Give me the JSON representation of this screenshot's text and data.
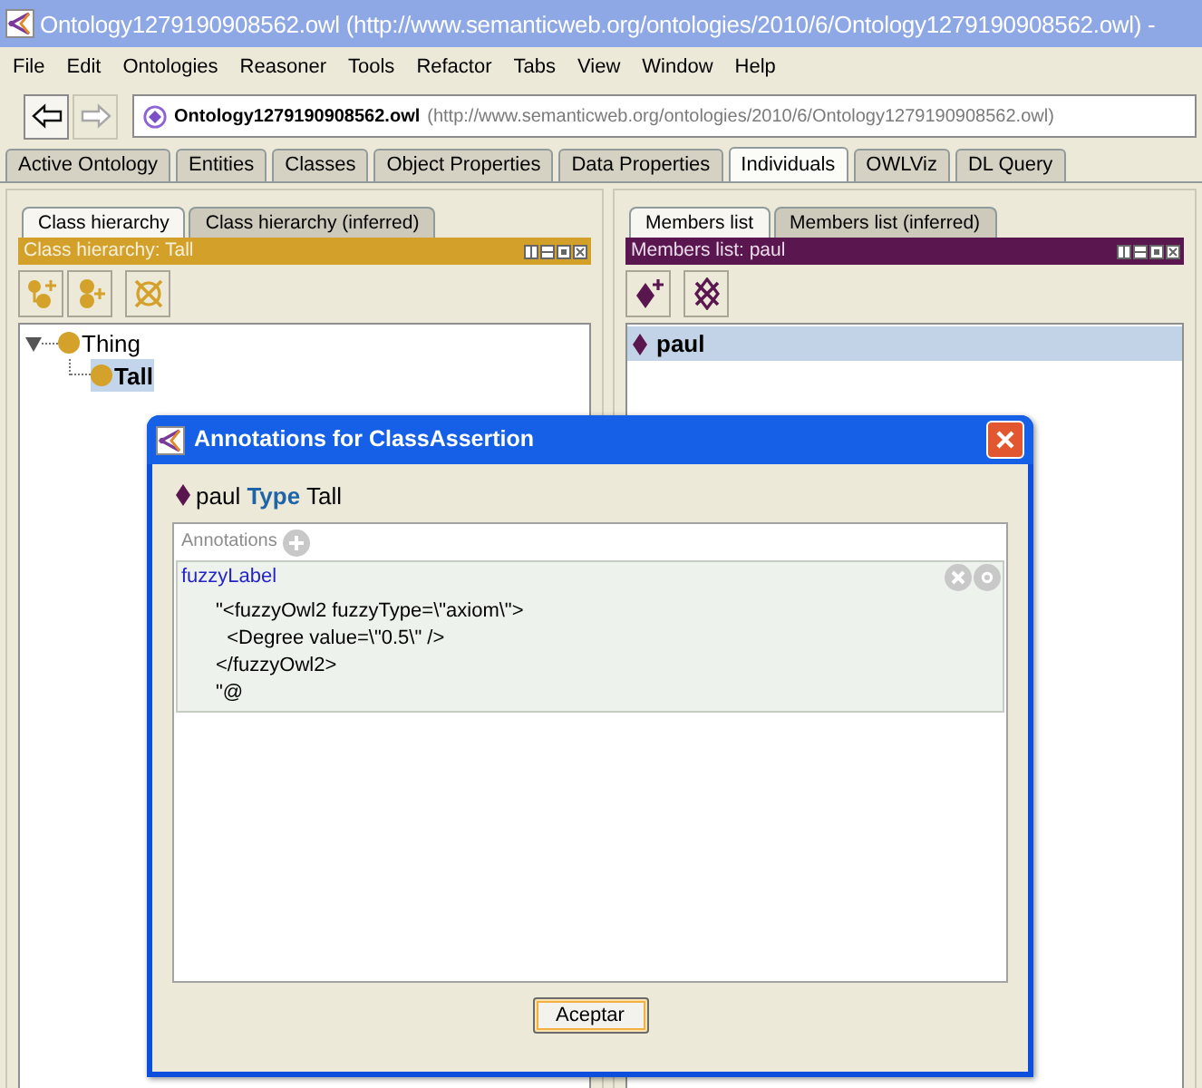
{
  "window": {
    "title": "Ontology1279190908562.owl (http://www.semanticweb.org/ontologies/2010/6/Ontology1279190908562.owl) -"
  },
  "menu": [
    "File",
    "Edit",
    "Ontologies",
    "Reasoner",
    "Tools",
    "Refactor",
    "Tabs",
    "View",
    "Window",
    "Help"
  ],
  "nav_buttons": [
    {
      "kind": "back",
      "disabled": false
    },
    {
      "kind": "forward",
      "disabled": true
    }
  ],
  "active_ontology": {
    "name": "Ontology1279190908562.owl",
    "iri": "(http://www.semanticweb.org/ontologies/2010/6/Ontology1279190908562.owl)"
  },
  "tabs": [
    {
      "label": "Active Ontology",
      "selected": false
    },
    {
      "label": "Entities",
      "selected": false
    },
    {
      "label": "Classes",
      "selected": false
    },
    {
      "label": "Object Properties",
      "selected": false
    },
    {
      "label": "Data Properties",
      "selected": false
    },
    {
      "label": "Individuals",
      "selected": true
    },
    {
      "label": "OWLViz",
      "selected": false
    },
    {
      "label": "DL Query",
      "selected": false
    }
  ],
  "left_panel": {
    "kind": "classes",
    "tabs": [
      {
        "label": "Class hierarchy",
        "selected": true
      },
      {
        "label": "Class hierarchy (inferred)",
        "selected": false
      }
    ],
    "header": "Class hierarchy: Tall",
    "tree": [
      {
        "label": "Thing",
        "expanded": true,
        "selected": false,
        "children": [
          {
            "label": "Tall",
            "selected": true
          }
        ]
      }
    ]
  },
  "right_panel": {
    "kind": "individuals",
    "tabs": [
      {
        "label": "Members list",
        "selected": true
      },
      {
        "label": "Members list (inferred)",
        "selected": false
      }
    ],
    "header": "Members list: paul",
    "members": [
      {
        "label": "paul",
        "selected": true
      }
    ]
  },
  "dialog": {
    "title": "Annotations for ClassAssertion",
    "axiom": "paul **Type** Tall",
    "annotations_label": "Annotations",
    "annotations": [
      {
        "property": "fuzzyLabel",
        "value": "\"<fuzzyOwl2 fuzzyType=\\\"axiom\\\">\n  <Degree value=\\\"0.5\\\" />\n</fuzzyOwl2>\n\"@"
      }
    ],
    "buttons": [
      "Aceptar"
    ]
  }
}
